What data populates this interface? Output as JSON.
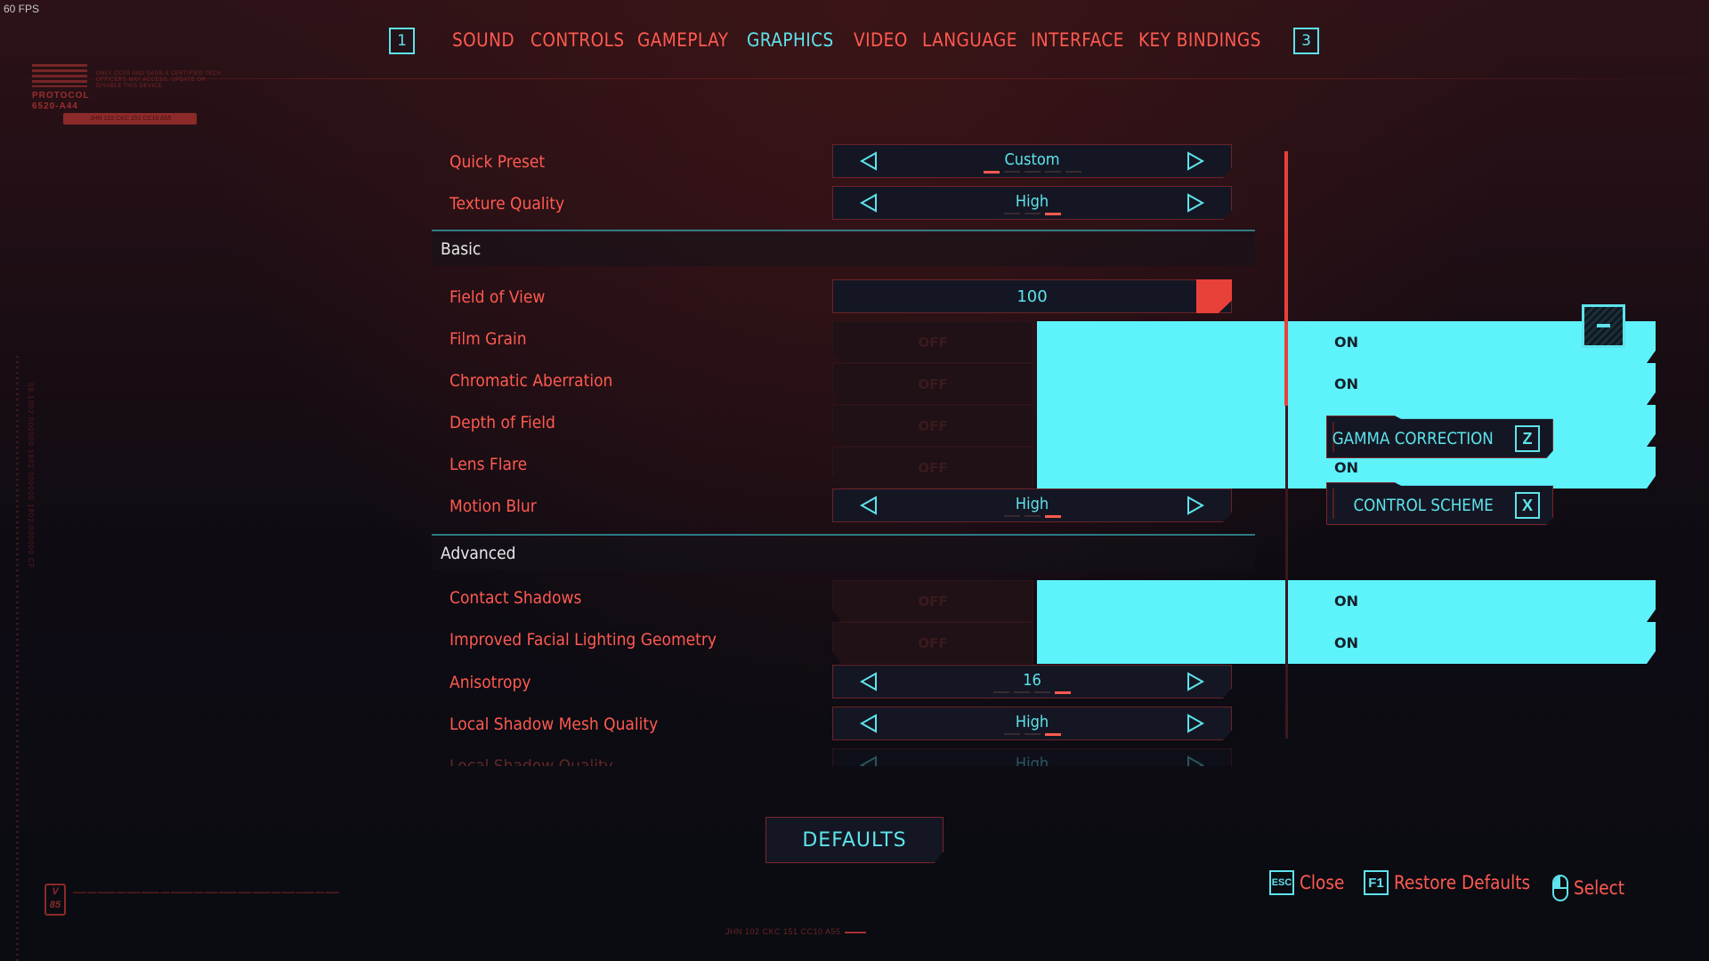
{
  "hud": {
    "fps": "60 FPS"
  },
  "decor": {
    "protocol_title": "PROTOCOL 6520-A44",
    "protocol_note": "ONLY CCSS AND SAGE-9 CERTIFIED TECH OFFICERS MAY ACCESS, UPDATE OR DISABLE THIS DEVICE.",
    "protocol_badge": "JHN 102 CKC 151 CC10 A55",
    "v_badge": "V 85",
    "serial": "JHN 102 CKC 151 CC10 A55",
    "vertical_code": "08 1002:000000 1802:000000 1802:000000 CF"
  },
  "tabs": {
    "prev_key": "1",
    "next_key": "3",
    "items": [
      {
        "label": "SOUND",
        "active": false
      },
      {
        "label": "CONTROLS",
        "active": false
      },
      {
        "label": "GAMEPLAY",
        "active": false
      },
      {
        "label": "GRAPHICS",
        "active": true
      },
      {
        "label": "VIDEO",
        "active": false
      },
      {
        "label": "LANGUAGE",
        "active": false
      },
      {
        "label": "INTERFACE",
        "active": false
      },
      {
        "label": "KEY BINDINGS",
        "active": false
      }
    ]
  },
  "settings": {
    "top": [
      {
        "label": "Quick Preset",
        "type": "selector",
        "value": "Custom",
        "options_count": 5,
        "selected_index": 0
      },
      {
        "label": "Texture Quality",
        "type": "selector",
        "value": "High",
        "options_count": 3,
        "selected_index": 2
      }
    ],
    "basic": {
      "title": "Basic",
      "items": [
        {
          "label": "Field of View",
          "type": "slider",
          "value": "100"
        },
        {
          "label": "Film Grain",
          "type": "toggle",
          "off_label": "OFF",
          "on_label": "ON",
          "state": "on"
        },
        {
          "label": "Chromatic Aberration",
          "type": "toggle",
          "off_label": "OFF",
          "on_label": "ON",
          "state": "on"
        },
        {
          "label": "Depth of Field",
          "type": "toggle",
          "off_label": "OFF",
          "on_label": "ON",
          "state": "on"
        },
        {
          "label": "Lens Flare",
          "type": "toggle",
          "off_label": "OFF",
          "on_label": "ON",
          "state": "on"
        },
        {
          "label": "Motion Blur",
          "type": "selector",
          "value": "High",
          "options_count": 3,
          "selected_index": 2
        }
      ]
    },
    "advanced": {
      "title": "Advanced",
      "items": [
        {
          "label": "Contact Shadows",
          "type": "toggle",
          "off_label": "OFF",
          "on_label": "ON",
          "state": "on"
        },
        {
          "label": "Improved Facial Lighting Geometry",
          "type": "toggle",
          "off_label": "OFF",
          "on_label": "ON",
          "state": "on"
        },
        {
          "label": "Anisotropy",
          "type": "selector",
          "value": "16",
          "options_count": 4,
          "selected_index": 3
        },
        {
          "label": "Local Shadow Mesh Quality",
          "type": "selector",
          "value": "High",
          "options_count": 3,
          "selected_index": 2
        },
        {
          "label": "Local Shadow Quality",
          "type": "selector",
          "value": "High",
          "options_count": 3,
          "selected_index": 2,
          "partially_visible": true
        }
      ]
    }
  },
  "side_buttons": [
    {
      "label": "GAMMA CORRECTION",
      "key": "Z"
    },
    {
      "label": "CONTROL SCHEME",
      "key": "X"
    }
  ],
  "defaults_button": "DEFAULTS",
  "footer_hints": [
    {
      "key": "ESC",
      "label": "Close"
    },
    {
      "key": "F1",
      "label": "Restore Defaults"
    },
    {
      "key": "mouse-left",
      "label": "Select"
    }
  ],
  "colors": {
    "accent_cyan": "#5ee3ec",
    "toggle_on": "#5ef2fb",
    "label_red": "#ff5a50",
    "slider_knob": "#e8413a",
    "background": "#0e0b13"
  }
}
